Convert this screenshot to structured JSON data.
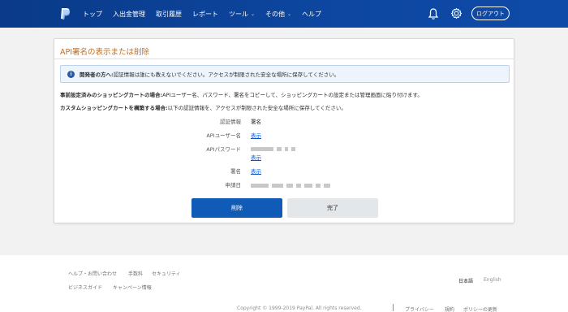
{
  "header": {
    "nav": [
      {
        "label": "トップ",
        "dropdown": false
      },
      {
        "label": "入出金管理",
        "dropdown": false
      },
      {
        "label": "取引履歴",
        "dropdown": false
      },
      {
        "label": "レポート",
        "dropdown": false
      },
      {
        "label": "ツール",
        "dropdown": true
      },
      {
        "label": "その他",
        "dropdown": true
      },
      {
        "label": "ヘルプ",
        "dropdown": false
      }
    ],
    "logout_label": "ログアウト"
  },
  "card": {
    "title": "API署名の表示または削除",
    "notice_bold": "開発者の方へ:",
    "notice_text": "認証情報は誰にも教えないでください。アクセスが制限された安全な場所に保存してください。",
    "line1_bold": "事前設定済みのショッピングカートの場合:",
    "line1_text": "APIユーザー名、パスワード、署名をコピーして、ショッピングカートの設定または管理画面に貼り付けます。",
    "line2_bold": "カスタムショッピングカートを構築する場合:",
    "line2_text": "以下の認証情報を、アクセスが制限された安全な場所に保存してください。",
    "fields": {
      "credential_label": "認証情報",
      "credential_value": "署名",
      "username_label": "APIユーザー名",
      "username_link": "表示",
      "password_label": "APIパスワード",
      "password_link": "表示",
      "signature_label": "署名",
      "signature_link": "表示",
      "date_label": "申請日"
    },
    "delete_button": "削除",
    "done_button": "完了"
  },
  "footer": {
    "links_row1": [
      "ヘルプ・お問い合わせ",
      "手数料",
      "セキュリティ"
    ],
    "links_row2": [
      "ビジネスガイド",
      "キャンペーン情報"
    ],
    "lang_active": "日本語",
    "lang_other": "English",
    "copyright": "Copyright © 1999-2019 PayPal. All rights reserved.",
    "legal_links": [
      "プライバシー",
      "規約",
      "ポリシーの更新"
    ]
  },
  "colors": {
    "header_bg": "#0d47a1",
    "title_orange": "#c26d1f",
    "primary_button": "#0f5bb5",
    "link": "#0b57c6"
  }
}
